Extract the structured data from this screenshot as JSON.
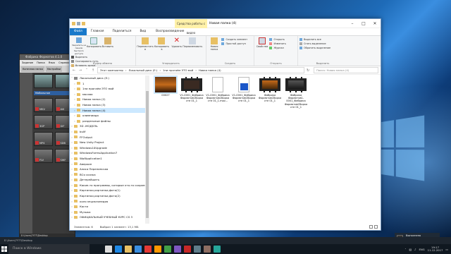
{
  "explorer": {
    "title": "Новая папка (4)",
    "context_tab": "Средства работы с видео",
    "tabs": [
      "Файл",
      "Главная",
      "Поделиться",
      "Вид",
      "Воспроизведение"
    ],
    "ribbon": {
      "clipboard": {
        "label": "Буфер обмена",
        "pin": "Закрепить на панели быстрого доступа",
        "copy": "Копировать",
        "paste": "Вставить",
        "cut": "Вырезать",
        "copy_path": "Скопировать путь",
        "paste_shortcut": "Вставить ярлык"
      },
      "organize": {
        "label": "Упорядочить",
        "move": "Переместить в",
        "copy_to": "Копировать в",
        "delete": "Удалить",
        "rename": "Переименовать"
      },
      "new": {
        "label": "Создать",
        "new_folder": "Новая папка",
        "new_item": "Создать элемент",
        "easy_access": "Простой доступ"
      },
      "open": {
        "label": "Открыть",
        "properties": "Свойства",
        "open": "Открыть",
        "edit": "Изменить",
        "history": "Журнал"
      },
      "select": {
        "label": "Выделить",
        "select_all": "Выделить все",
        "select_none": "Снять выделение",
        "invert": "Обратить выделение"
      }
    },
    "address": [
      "Этот компьютер",
      "Локальный диск (E:)",
      "1ни прогаём ЭТО мой",
      "Новая папка (4)"
    ],
    "search_placeholder": "Поиск: Новая папка (4)",
    "nav": [
      {
        "label": "Локальный диск (E:)",
        "type": "drive"
      },
      {
        "label": "1",
        "type": "folder"
      },
      {
        "label": "1ни прогаём ЭТО мой",
        "type": "folder"
      },
      {
        "label": "москва",
        "type": "folder"
      },
      {
        "label": "Новая папка (2)",
        "type": "folder"
      },
      {
        "label": "Новая папка (3)",
        "type": "folder"
      },
      {
        "label": "Новая папка (4)",
        "type": "folder",
        "selected": true
      },
      {
        "label": "олимпиада",
        "type": "folder"
      },
      {
        "label": "раздельные файлы",
        "type": "folder"
      },
      {
        "label": "3D -МОДЕЛЬ",
        "type": "folder"
      },
      {
        "label": "bullf",
        "type": "folder"
      },
      {
        "label": "FFOutput",
        "type": "folder"
      },
      {
        "label": "New Unity Project",
        "type": "folder"
      },
      {
        "label": "Windows10Upgrade",
        "type": "folder"
      },
      {
        "label": "WindowsFormsApplication7",
        "type": "folder"
      },
      {
        "label": "WpfApplication1",
        "type": "folder"
      },
      {
        "label": "Аверкин",
        "type": "folder"
      },
      {
        "label": "Алиса Перелинская",
        "type": "folder"
      },
      {
        "label": "ВСя сказка",
        "type": "folder"
      },
      {
        "label": "Детерейшить",
        "type": "folder"
      },
      {
        "label": "Какие-то программы, которые кто-то сохранил",
        "type": "folder"
      },
      {
        "label": "Картинки,картинки,фото(1)",
        "type": "folder"
      },
      {
        "label": "Картинки,картинки,фото(2)",
        "type": "folder"
      },
      {
        "label": "коля энциклопедия",
        "type": "folder"
      },
      {
        "label": "Кости",
        "type": "folder"
      },
      {
        "label": "Музыка",
        "type": "folder"
      },
      {
        "label": "ОФИЦИАЛЬНЫЙ УЧЕБНЫЙ КУРС CS 3",
        "type": "folder"
      }
    ],
    "files": [
      {
        "name": "00027",
        "kind": "photo",
        "selected": true
      },
      {
        "name": "V1-0001_Фабрика ФорматовСборка сте 01_1",
        "kind": "film"
      },
      {
        "name": "V1-0001_Фабрика ФорматовСборка сте 01_1.mov...",
        "kind": "doc"
      },
      {
        "name": "V1-0001_Фабрика ФорматовСборка сте 01_1",
        "kind": "blue"
      },
      {
        "name": "Фабрика ФорматовСборка сте 01_1",
        "kind": "film2"
      },
      {
        "name": "Фабрика Форматов1-0001_Фабрика ФорматовСборка сте 01_1",
        "kind": "film3"
      }
    ],
    "status": {
      "count": "Элементов: 6",
      "selection": "Выбран 1 элемент: 13,1 МБ"
    }
  },
  "format_factory": {
    "title": "Фабрика Форматов 4.1.0",
    "menu": [
      "Задание",
      "Папка",
      "Язык",
      "Справка"
    ],
    "toolbar": [
      "Конечная папка",
      "Настройки",
      "Удалить"
    ],
    "category": "Мобильное",
    "formats": [
      "MKV",
      "AVI",
      "3GP",
      "GIF",
      "MP4",
      "SDB",
      "FLV",
      "SWF"
    ],
    "status_path": "E:\\Users\\?Y??\\Desktop",
    "status_note": "Выход: всё выполнено"
  },
  "taskbar": {
    "search_placeholder": "Поиск в Windows",
    "lang": "ENG",
    "time": "19:17",
    "date": "11.12.2017"
  },
  "notification": {
    "title": "Выполнено",
    "text": "Истекшее время: 00:00:05"
  },
  "colors": {
    "accent": "#1979ca",
    "selection": "#cce8ff",
    "folder": "#e8c064"
  }
}
